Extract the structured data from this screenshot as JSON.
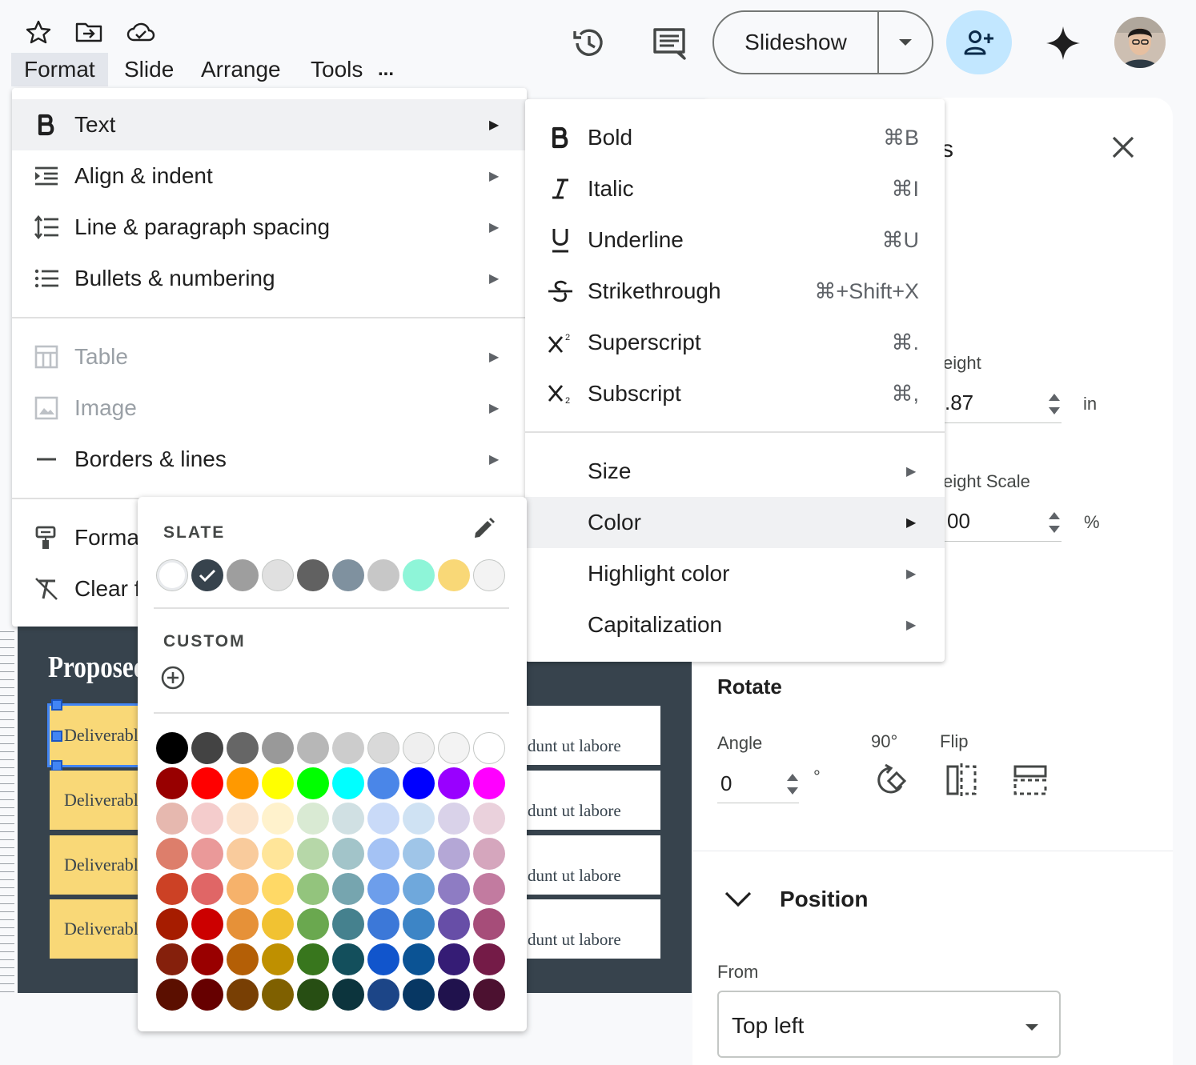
{
  "menubar": {
    "items": [
      "Format",
      "Slide",
      "Arrange",
      "Tools",
      "..."
    ]
  },
  "header": {
    "slideshow_label": "Slideshow"
  },
  "format_menu": {
    "items": [
      {
        "label": "Text",
        "icon": "bold-icon",
        "enabled": true
      },
      {
        "label": "Align & indent",
        "icon": "align-indent-icon",
        "enabled": true
      },
      {
        "label": "Line & paragraph spacing",
        "icon": "line-spacing-icon",
        "enabled": true
      },
      {
        "label": "Bullets & numbering",
        "icon": "bulleted-list-icon",
        "enabled": true
      },
      {
        "label": "Table",
        "icon": "table-icon",
        "enabled": false
      },
      {
        "label": "Image",
        "icon": "image-icon",
        "enabled": false
      },
      {
        "label": "Borders & lines",
        "icon": "border-line-icon",
        "enabled": true
      },
      {
        "label": "Forma",
        "icon": "paint-format-icon",
        "enabled": true
      },
      {
        "label": "Clear f",
        "icon": "clear-formatting-icon",
        "enabled": true
      }
    ]
  },
  "text_menu": {
    "items": [
      {
        "label": "Bold",
        "shortcut": "⌘B",
        "icon": "bold-icon"
      },
      {
        "label": "Italic",
        "shortcut": "⌘I",
        "icon": "italic-icon"
      },
      {
        "label": "Underline",
        "shortcut": "⌘U",
        "icon": "underline-icon"
      },
      {
        "label": "Strikethrough",
        "shortcut": "⌘+Shift+X",
        "icon": "strikethrough-icon"
      },
      {
        "label": "Superscript",
        "shortcut": "⌘.",
        "icon": "superscript-icon"
      },
      {
        "label": "Subscript",
        "shortcut": "⌘,",
        "icon": "subscript-icon"
      }
    ],
    "more": [
      "Size",
      "Color",
      "Highlight color",
      "Capitalization"
    ]
  },
  "palette": {
    "theme_heading": "SLATE",
    "custom_heading": "CUSTOM",
    "theme_colors": [
      "#ffffff",
      "#37434d",
      "#9e9e9e",
      "#e0e0e0",
      "#616161",
      "#7f919f",
      "#c7c7c7",
      "#8ef5d8",
      "#f9d877",
      "#f3f3f3"
    ],
    "selected_theme_index": 1,
    "grid": [
      [
        "#000000",
        "#434343",
        "#666666",
        "#999999",
        "#b7b7b7",
        "#cccccc",
        "#d9d9d9",
        "#efefef",
        "#f3f3f3",
        "#ffffff"
      ],
      [
        "#980000",
        "#ff0000",
        "#ff9900",
        "#ffff00",
        "#00ff00",
        "#00ffff",
        "#4a86e8",
        "#0000ff",
        "#9900ff",
        "#ff00ff"
      ],
      [
        "#e6b8af",
        "#f4cccc",
        "#fce5cd",
        "#fff2cc",
        "#d9ead3",
        "#d0e0e3",
        "#c9daf8",
        "#cfe2f3",
        "#d9d2e9",
        "#ead1dc"
      ],
      [
        "#dd7e6b",
        "#ea9999",
        "#f9cb9c",
        "#ffe599",
        "#b6d7a8",
        "#a2c4c9",
        "#a4c2f4",
        "#9fc5e8",
        "#b4a7d6",
        "#d5a6bd"
      ],
      [
        "#cc4125",
        "#e06666",
        "#f6b26b",
        "#ffd966",
        "#93c47d",
        "#76a5af",
        "#6d9eeb",
        "#6fa8dc",
        "#8e7cc3",
        "#c27ba0"
      ],
      [
        "#a61c00",
        "#cc0000",
        "#e69138",
        "#f1c232",
        "#6aa84f",
        "#45818e",
        "#3c78d8",
        "#3d85c6",
        "#674ea7",
        "#a64d79"
      ],
      [
        "#85200c",
        "#990000",
        "#b45f06",
        "#bf9000",
        "#38761d",
        "#134f5c",
        "#1155cc",
        "#0b5394",
        "#351c75",
        "#741b47"
      ],
      [
        "#5b0f00",
        "#660000",
        "#783f04",
        "#7f6000",
        "#274e13",
        "#0c343d",
        "#1c4587",
        "#073763",
        "#20124d",
        "#4c1130"
      ]
    ]
  },
  "side_panel": {
    "title_fragment": "s",
    "height_label": "eight",
    "height_value": ".87",
    "height_unit": "in",
    "height_scale_label": "eight Scale",
    "height_scale_value": "00",
    "height_scale_unit": "%",
    "rotate_heading": "Rotate",
    "angle_label": "Angle",
    "angle_value": "0",
    "angle_unit": "°",
    "rotate90_label": "90°",
    "flip_label": "Flip",
    "position_heading": "Position",
    "from_label": "From",
    "from_value": "Top left"
  },
  "slide": {
    "title_fragment": "Proposed",
    "deliverables": [
      "Deliverabl",
      "Deliverabl",
      "Deliverabl",
      "Deliverabl"
    ],
    "card_text": [
      "dunt ut labore",
      "dunt ut labore",
      "dunt ut labore",
      "dunt ut labore"
    ]
  }
}
